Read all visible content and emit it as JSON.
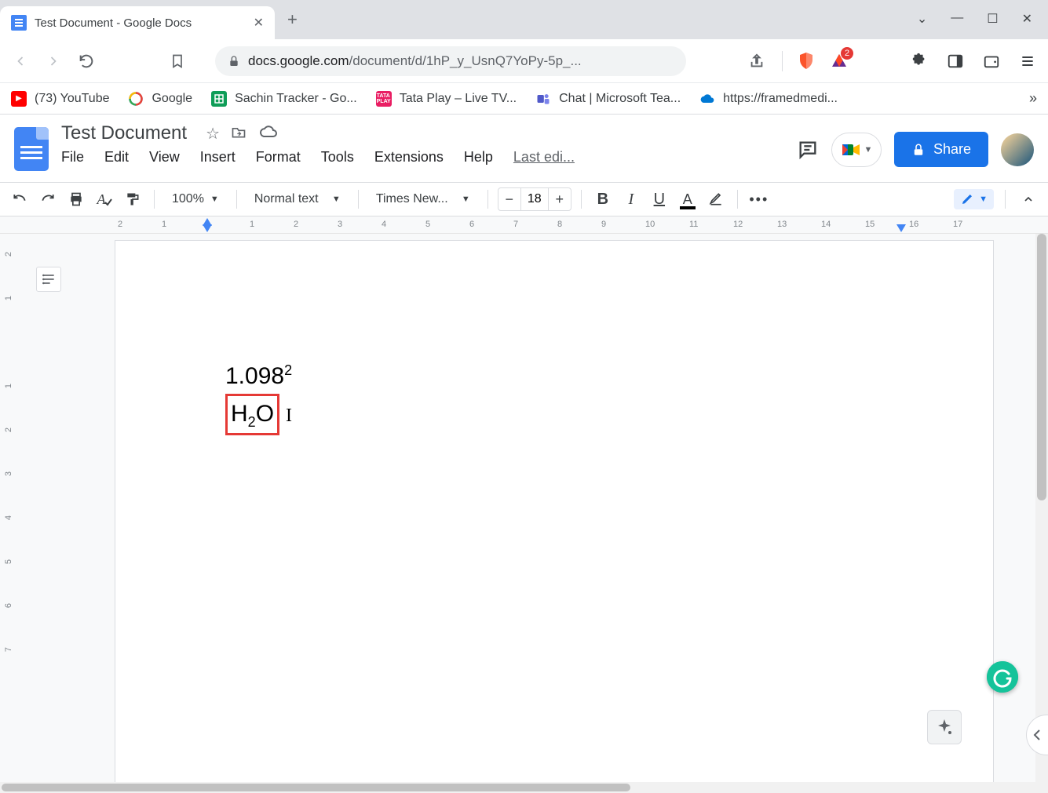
{
  "browser": {
    "tab_title": "Test Document - Google Docs",
    "url_prefix": "docs.google.com",
    "url_path": "/document/d/1hP_y_UsnQ7YoPy-5p_...",
    "badge_count": "2"
  },
  "bookmarks": [
    {
      "label": "(73) YouTube"
    },
    {
      "label": "Google"
    },
    {
      "label": "Sachin Tracker - Go..."
    },
    {
      "label": "Tata Play – Live TV..."
    },
    {
      "label": "Chat | Microsoft Tea..."
    },
    {
      "label": "https://framedmedi..."
    }
  ],
  "docs": {
    "title": "Test Document",
    "menu": [
      "File",
      "Edit",
      "View",
      "Insert",
      "Format",
      "Tools",
      "Extensions",
      "Help"
    ],
    "last_edit": "Last edi...",
    "share_label": "Share",
    "toolbar": {
      "zoom": "100%",
      "style": "Normal text",
      "font": "Times New...",
      "font_size": "18"
    }
  },
  "document_content": {
    "line1_base": "1.098",
    "line1_sup": "2",
    "line2_h": "H",
    "line2_sub": "2",
    "line2_o": "O"
  },
  "hruler_marks": [
    "2",
    "1",
    "",
    "1",
    "2",
    "3",
    "4",
    "5",
    "6",
    "7",
    "8",
    "9",
    "10",
    "11",
    "12",
    "13",
    "14",
    "15",
    "16",
    "17"
  ],
  "vruler_marks": [
    "2",
    "1",
    "",
    "1",
    "2",
    "3",
    "4",
    "5",
    "6",
    "7"
  ]
}
